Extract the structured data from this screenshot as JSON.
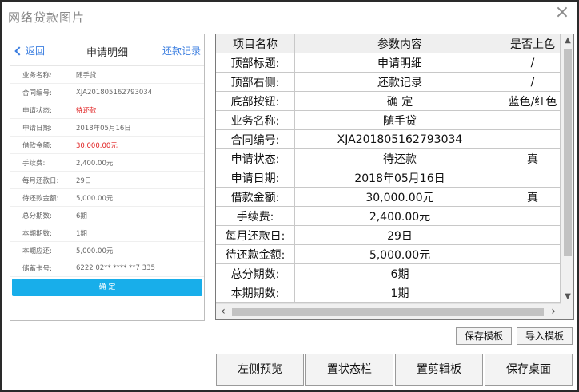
{
  "window": {
    "title": "网络贷款图片",
    "close_glyph": "×"
  },
  "phone": {
    "back_label": "返回",
    "title": "申请明细",
    "right_label": "还款记录",
    "rows": [
      {
        "label": "业务名称:",
        "value": "随手贷",
        "red": false
      },
      {
        "label": "合同编号:",
        "value": "XJA201805162793034",
        "red": false
      },
      {
        "label": "申请状态:",
        "value": "待还款",
        "red": true
      },
      {
        "label": "申请日期:",
        "value": "2018年05月16日",
        "red": false
      },
      {
        "label": "借款金额:",
        "value": "30,000.00元",
        "red": true
      },
      {
        "label": "手续费:",
        "value": "2,400.00元",
        "red": false
      },
      {
        "label": "每月还款日:",
        "value": "29日",
        "red": false
      },
      {
        "label": "待还款金额:",
        "value": "5,000.00元",
        "red": false
      },
      {
        "label": "总分期数:",
        "value": "6期",
        "red": false
      },
      {
        "label": "本期期数:",
        "value": "1期",
        "red": false
      },
      {
        "label": "本期应还:",
        "value": "5,000.00元",
        "red": false
      },
      {
        "label": "储蓄卡号:",
        "value": "6222 02** **** **7 335",
        "red": false
      }
    ],
    "button_label": "确  定"
  },
  "table": {
    "headers": [
      "项目名称",
      "参数内容",
      "是否上色"
    ],
    "rows": [
      [
        "顶部标题:",
        "申请明细",
        "/"
      ],
      [
        "顶部右侧:",
        "还款记录",
        "/"
      ],
      [
        "底部按钮:",
        "确    定",
        "蓝色/红色"
      ],
      [
        "业务名称:",
        "随手贷",
        ""
      ],
      [
        "合同编号:",
        "XJA201805162793034",
        ""
      ],
      [
        "申请状态:",
        "待还款",
        "真"
      ],
      [
        "申请日期:",
        "2018年05月16日",
        ""
      ],
      [
        "借款金额:",
        "30,000.00元",
        "真"
      ],
      [
        "手续费:",
        "2,400.00元",
        ""
      ],
      [
        "每月还款日:",
        "29日",
        ""
      ],
      [
        "待还款金额:",
        "5,000.00元",
        ""
      ],
      [
        "总分期数:",
        "6期",
        ""
      ],
      [
        "本期期数:",
        "1期",
        ""
      ]
    ]
  },
  "scroll_glyphs": {
    "up": "▲",
    "down": "▼",
    "left": "‹",
    "right": "›"
  },
  "buttons": {
    "save_template": "保存模板",
    "import_template": "导入模板",
    "left_preview": "左侧预览",
    "set_status_bar": "置状态栏",
    "set_clipboard": "置剪辑板",
    "save_desktop": "保存桌面"
  },
  "colors": {
    "accent_blue": "#3d7fe0",
    "button_blue": "#18aeea",
    "alert_red": "#e02020"
  }
}
